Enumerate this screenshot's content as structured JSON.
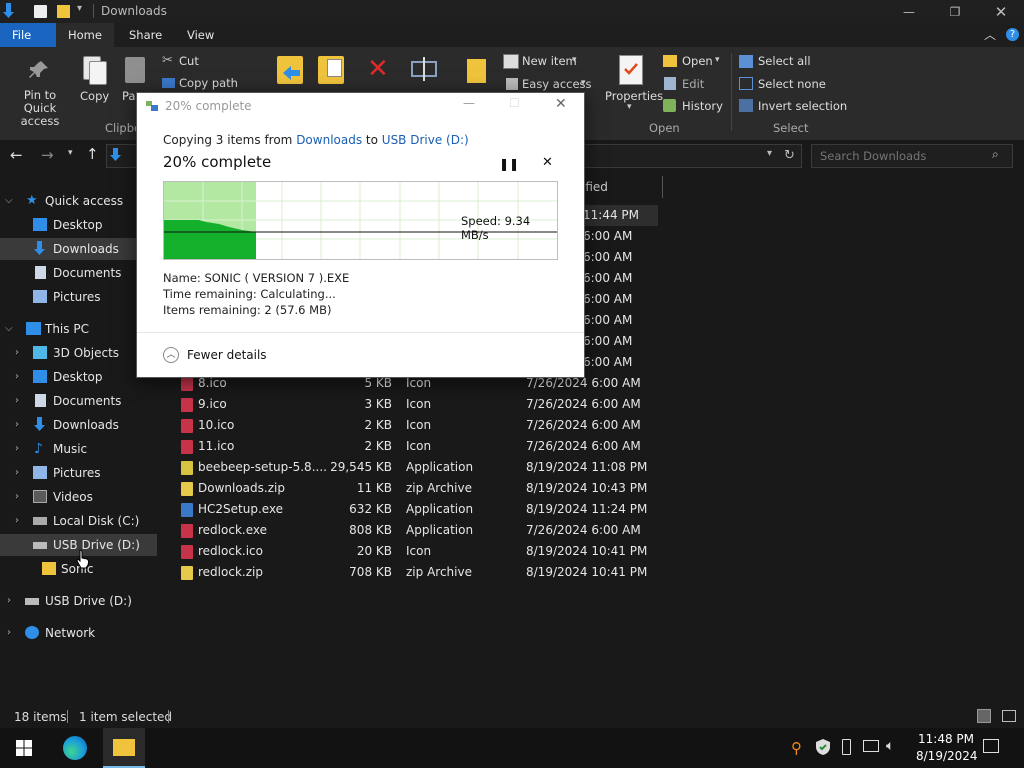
{
  "window": {
    "title": "Downloads"
  },
  "ribbon_tabs": [
    "File",
    "Home",
    "Share",
    "View"
  ],
  "ribbon": {
    "pin_label": "Pin to Quick access",
    "copy_label": "Copy",
    "paste_label": "Pa",
    "cut_label": "Cut",
    "copy_path_label": "Copy path",
    "clipboard_group": "Clipbo",
    "new_item_label": "New item",
    "easy_access_label": "Easy access",
    "properties_label": "Properties",
    "open_label": "Open",
    "edit_label": "Edit",
    "history_label": "History",
    "open_group": "Open",
    "select_all_label": "Select all",
    "select_none_label": "Select none",
    "invert_selection_label": "Invert selection",
    "select_group": "Select"
  },
  "search": {
    "placeholder": "Search Downloads"
  },
  "columns": {
    "modified_partial": "ified"
  },
  "sidebar": {
    "quick_access": "Quick access",
    "desktop": "Desktop",
    "downloads": "Downloads",
    "documents": "Documents",
    "pictures": "Pictures",
    "this_pc": "This PC",
    "objects3d": "3D Objects",
    "pc_desktop": "Desktop",
    "pc_documents": "Documents",
    "pc_downloads": "Downloads",
    "music": "Music",
    "pc_pictures": "Pictures",
    "videos": "Videos",
    "local_disk": "Local Disk (C:)",
    "usb_drive": "USB Drive (D:)",
    "sonic_folder": "Sonic",
    "usb_drive2": "USB Drive (D:)",
    "network": "Network"
  },
  "hidden_dates": [
    "11:44 PM",
    "6:00 AM",
    "6:00 AM",
    "6:00 AM",
    "6:00 AM",
    "6:00 AM",
    "6:00 AM",
    "6:00 AM"
  ],
  "files": [
    {
      "name": "8.ico",
      "size": "5 KB",
      "type": "Icon",
      "date": "7/26/2024 6:00 AM",
      "icon_color": "#c8334a"
    },
    {
      "name": "9.ico",
      "size": "3 KB",
      "type": "Icon",
      "date": "7/26/2024 6:00 AM",
      "icon_color": "#c8334a"
    },
    {
      "name": "10.ico",
      "size": "2 KB",
      "type": "Icon",
      "date": "7/26/2024 6:00 AM",
      "icon_color": "#c8334a"
    },
    {
      "name": "11.ico",
      "size": "2 KB",
      "type": "Icon",
      "date": "7/26/2024 6:00 AM",
      "icon_color": "#c8334a"
    },
    {
      "name": "beebeep-setup-5.8....",
      "size": "29,545 KB",
      "type": "Application",
      "date": "8/19/2024 11:08 PM",
      "icon_color": "#d8c341"
    },
    {
      "name": "Downloads.zip",
      "size": "11 KB",
      "type": "zip Archive",
      "date": "8/19/2024 10:43 PM",
      "icon_color": "#e6c84a"
    },
    {
      "name": "HC2Setup.exe",
      "size": "632 KB",
      "type": "Application",
      "date": "8/19/2024 11:24 PM",
      "icon_color": "#3a78c8"
    },
    {
      "name": "redlock.exe",
      "size": "808 KB",
      "type": "Application",
      "date": "7/26/2024 6:00 AM",
      "icon_color": "#c8334a"
    },
    {
      "name": "redlock.ico",
      "size": "20 KB",
      "type": "Icon",
      "date": "8/19/2024 10:41 PM",
      "icon_color": "#c8334a"
    },
    {
      "name": "redlock.zip",
      "size": "708 KB",
      "type": "zip Archive",
      "date": "8/19/2024 10:41 PM",
      "icon_color": "#e6c84a"
    }
  ],
  "dialog": {
    "title": "20% complete",
    "copying_prefix": "Copying 3 items from ",
    "source": "Downloads",
    "to_word": " to ",
    "destination": "USB Drive (D:)",
    "heading": "20% complete",
    "progress_fraction": 0.2,
    "speed": "Speed: 9.34 MB/s",
    "name_line": "Name:  SONIC ( VERSION 7 ).EXE",
    "time_line": "Time remaining:  Calculating...",
    "items_line": "Items remaining:  2 (57.6 MB)",
    "fewer_details": "Fewer details"
  },
  "status": {
    "items": "18 items",
    "selected": "1 item selected"
  },
  "clock": {
    "time": "11:48 PM",
    "date": "8/19/2024"
  }
}
